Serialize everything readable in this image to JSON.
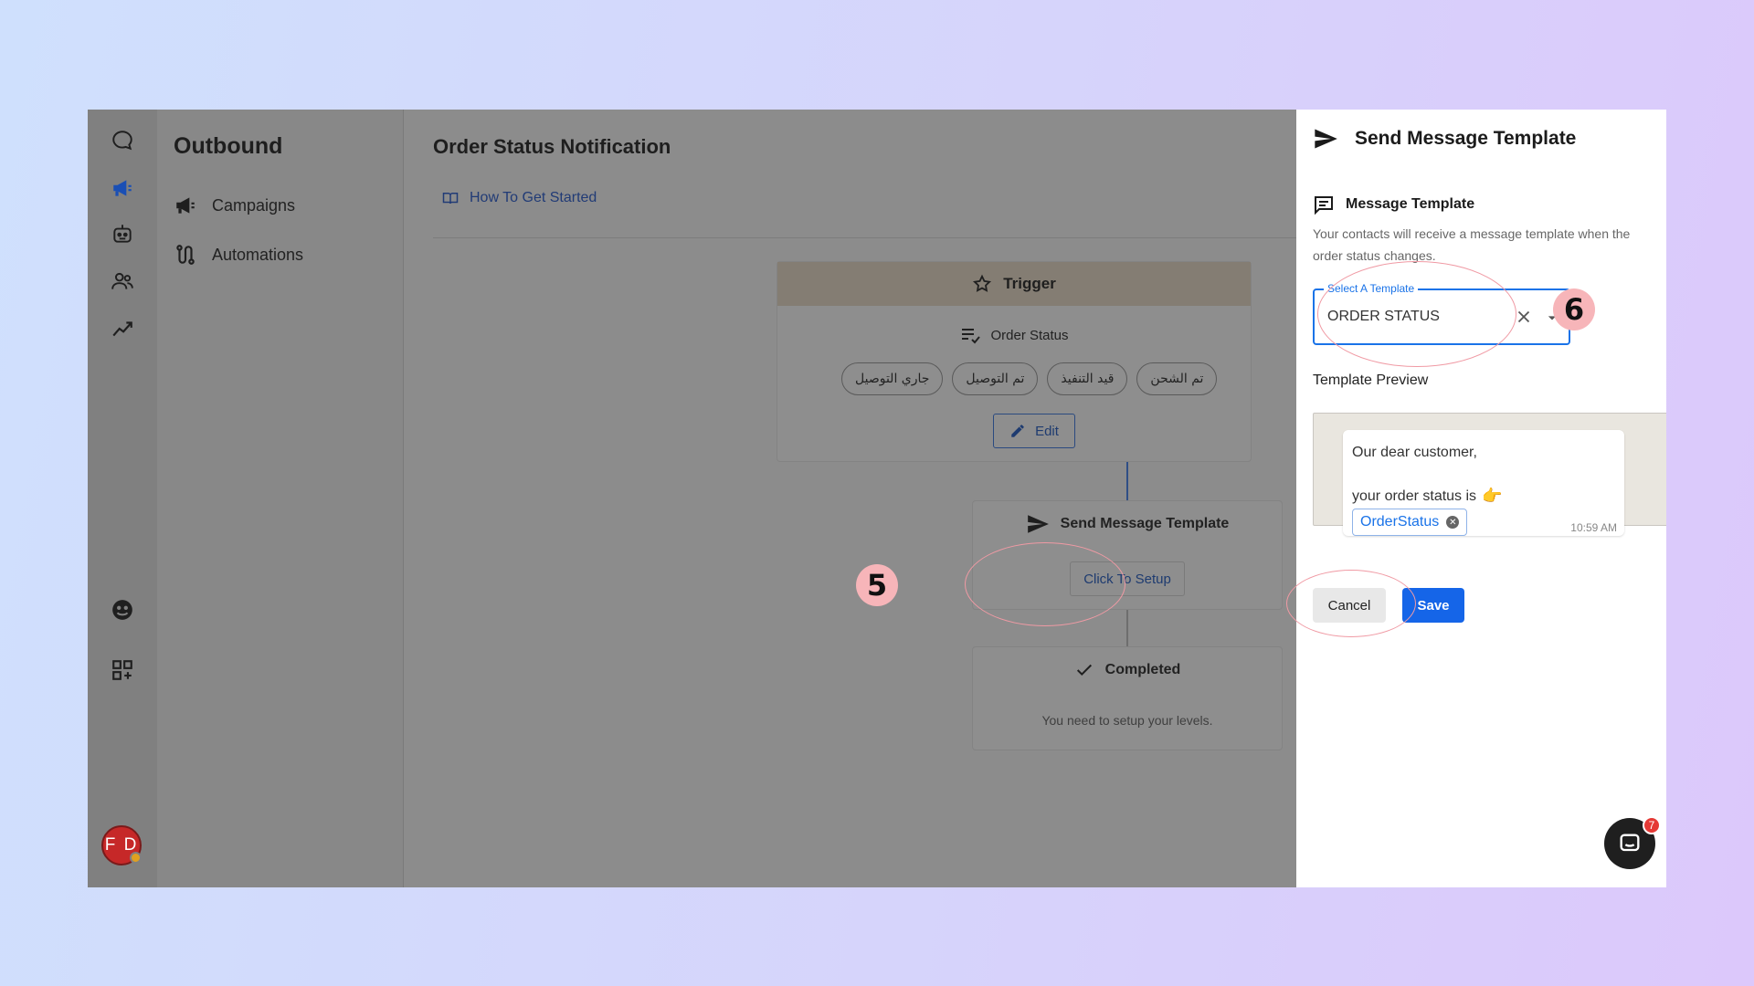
{
  "rail": {
    "icons": [
      "chat-bubble-icon",
      "megaphone-icon",
      "robot-icon",
      "contacts-icon",
      "analytics-icon",
      "support-icon",
      "apps-icon"
    ],
    "avatar_initials": "F D",
    "active_color": "#1a4fb5"
  },
  "subnav": {
    "title": "Outbound",
    "items": [
      {
        "label": "Campaigns",
        "icon": "megaphone-icon"
      },
      {
        "label": "Automations",
        "icon": "automation-icon"
      }
    ]
  },
  "main": {
    "title": "Order Status Notification",
    "help_link": "How To Get Started",
    "trigger": {
      "title": "Trigger",
      "subtitle": "Order Status",
      "chips": [
        "جاري التوصيل",
        "تم التوصيل",
        "قيد التنفيذ",
        "تم الشحن"
      ],
      "edit_label": "Edit"
    },
    "send_step": {
      "title": "Send Message Template",
      "button": "Click To Setup"
    },
    "completed_step": {
      "title": "Completed",
      "note": "You need to setup your levels."
    }
  },
  "drawer": {
    "title": "Send Message Template",
    "section_title": "Message Template",
    "section_desc": "Your contacts will receive a message template when the order status changes.",
    "select": {
      "label": "Select A Template",
      "value": "ORDER STATUS"
    },
    "preview_label": "Template Preview",
    "preview": {
      "line1": "Our dear customer,",
      "line2": "your order status is",
      "variable": "OrderStatus",
      "time": "10:59 AM"
    },
    "cancel_label": "Cancel",
    "save_label": "Save"
  },
  "chat_launcher": {
    "badge": "7"
  },
  "annotations": {
    "step5": "5",
    "step6": "6"
  },
  "colors": {
    "primary": "#1565e8",
    "annotation": "#f7b5b9",
    "overlay": "#8c8c8c"
  }
}
